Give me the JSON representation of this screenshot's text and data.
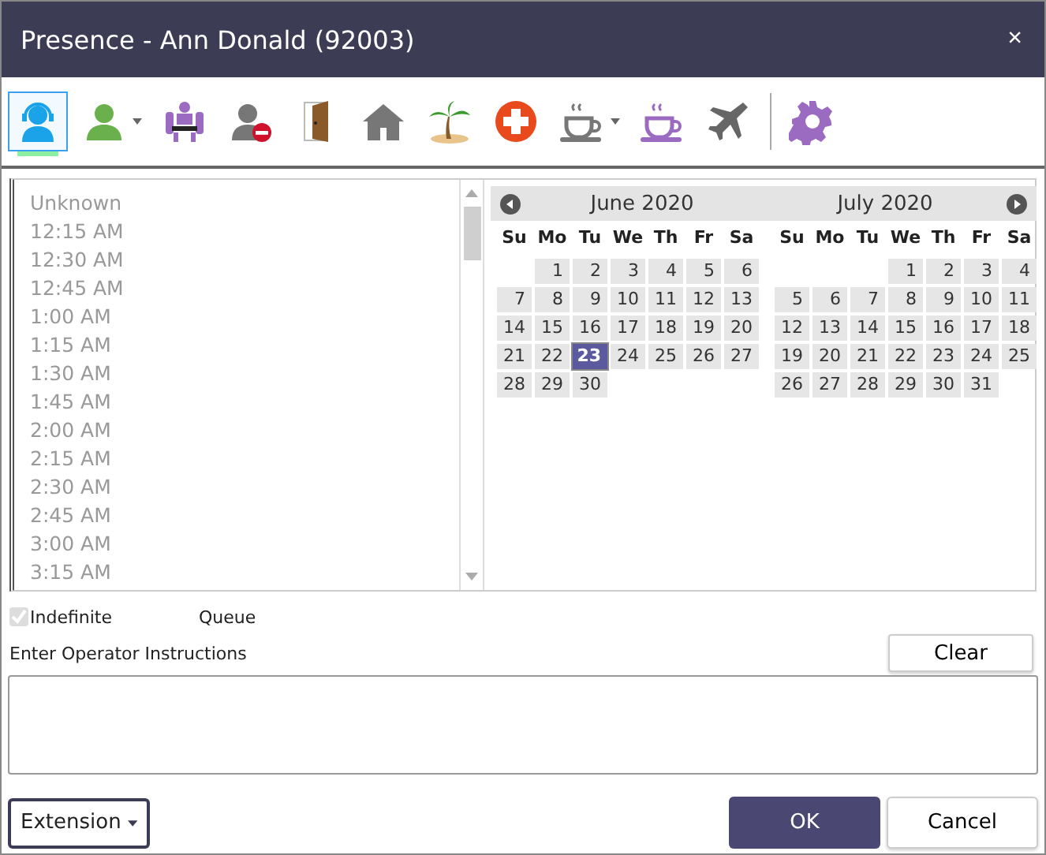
{
  "window": {
    "title": "Presence - Ann Donald (92003)",
    "close": "×"
  },
  "toolbar": [
    {
      "kind": "agent",
      "selected": true,
      "dropdown": false
    },
    {
      "kind": "available",
      "selected": false,
      "dropdown": true
    },
    {
      "kind": "meeting",
      "selected": false,
      "dropdown": false
    },
    {
      "kind": "unavailable",
      "selected": false,
      "dropdown": false
    },
    {
      "kind": "door",
      "selected": false,
      "dropdown": false
    },
    {
      "kind": "home",
      "selected": false,
      "dropdown": false
    },
    {
      "kind": "vacation",
      "selected": false,
      "dropdown": false
    },
    {
      "kind": "sick",
      "selected": false,
      "dropdown": false
    },
    {
      "kind": "break",
      "selected": false,
      "dropdown": true
    },
    {
      "kind": "lunch",
      "selected": false,
      "dropdown": false
    },
    {
      "kind": "travel",
      "selected": false,
      "dropdown": false
    },
    {
      "kind": "separator"
    },
    {
      "kind": "settings",
      "selected": false,
      "dropdown": false
    }
  ],
  "times": [
    "Unknown",
    "12:15 AM",
    "12:30 AM",
    "12:45 AM",
    "1:00 AM",
    "1:15 AM",
    "1:30 AM",
    "1:45 AM",
    "2:00 AM",
    "2:15 AM",
    "2:30 AM",
    "2:45 AM",
    "3:00 AM",
    "3:15 AM"
  ],
  "calendar": {
    "months": [
      {
        "title": "June 2020",
        "weekdays": [
          "Su",
          "Mo",
          "Tu",
          "We",
          "Th",
          "Fr",
          "Sa"
        ],
        "weeks": [
          [
            {
              "kind": "empty"
            },
            {
              "kind": "day",
              "label": "1",
              "selected": false
            },
            {
              "kind": "day",
              "label": "2",
              "selected": false
            },
            {
              "kind": "day",
              "label": "3",
              "selected": false
            },
            {
              "kind": "day",
              "label": "4",
              "selected": false
            },
            {
              "kind": "day",
              "label": "5",
              "selected": false
            },
            {
              "kind": "day",
              "label": "6",
              "selected": false
            }
          ],
          [
            {
              "kind": "day",
              "label": "7",
              "selected": false
            },
            {
              "kind": "day",
              "label": "8",
              "selected": false
            },
            {
              "kind": "day",
              "label": "9",
              "selected": false
            },
            {
              "kind": "day",
              "label": "10",
              "selected": false
            },
            {
              "kind": "day",
              "label": "11",
              "selected": false
            },
            {
              "kind": "day",
              "label": "12",
              "selected": false
            },
            {
              "kind": "day",
              "label": "13",
              "selected": false
            }
          ],
          [
            {
              "kind": "day",
              "label": "14",
              "selected": false
            },
            {
              "kind": "day",
              "label": "15",
              "selected": false
            },
            {
              "kind": "day",
              "label": "16",
              "selected": false
            },
            {
              "kind": "day",
              "label": "17",
              "selected": false
            },
            {
              "kind": "day",
              "label": "18",
              "selected": false
            },
            {
              "kind": "day",
              "label": "19",
              "selected": false
            },
            {
              "kind": "day",
              "label": "20",
              "selected": false
            }
          ],
          [
            {
              "kind": "day",
              "label": "21",
              "selected": false
            },
            {
              "kind": "day",
              "label": "22",
              "selected": false
            },
            {
              "kind": "day",
              "label": "23",
              "selected": true
            },
            {
              "kind": "day",
              "label": "24",
              "selected": false
            },
            {
              "kind": "day",
              "label": "25",
              "selected": false
            },
            {
              "kind": "day",
              "label": "26",
              "selected": false
            },
            {
              "kind": "day",
              "label": "27",
              "selected": false
            }
          ],
          [
            {
              "kind": "day",
              "label": "28",
              "selected": false
            },
            {
              "kind": "day",
              "label": "29",
              "selected": false
            },
            {
              "kind": "day",
              "label": "30",
              "selected": false
            }
          ]
        ]
      },
      {
        "title": "July 2020",
        "weekdays": [
          "Su",
          "Mo",
          "Tu",
          "We",
          "Th",
          "Fr",
          "Sa"
        ],
        "weeks": [
          [
            {
              "kind": "empty"
            },
            {
              "kind": "empty"
            },
            {
              "kind": "empty"
            },
            {
              "kind": "day",
              "label": "1",
              "selected": false
            },
            {
              "kind": "day",
              "label": "2",
              "selected": false
            },
            {
              "kind": "day",
              "label": "3",
              "selected": false
            },
            {
              "kind": "day",
              "label": "4",
              "selected": false
            }
          ],
          [
            {
              "kind": "day",
              "label": "5",
              "selected": false
            },
            {
              "kind": "day",
              "label": "6",
              "selected": false
            },
            {
              "kind": "day",
              "label": "7",
              "selected": false
            },
            {
              "kind": "day",
              "label": "8",
              "selected": false
            },
            {
              "kind": "day",
              "label": "9",
              "selected": false
            },
            {
              "kind": "day",
              "label": "10",
              "selected": false
            },
            {
              "kind": "day",
              "label": "11",
              "selected": false
            }
          ],
          [
            {
              "kind": "day",
              "label": "12",
              "selected": false
            },
            {
              "kind": "day",
              "label": "13",
              "selected": false
            },
            {
              "kind": "day",
              "label": "14",
              "selected": false
            },
            {
              "kind": "day",
              "label": "15",
              "selected": false
            },
            {
              "kind": "day",
              "label": "16",
              "selected": false
            },
            {
              "kind": "day",
              "label": "17",
              "selected": false
            },
            {
              "kind": "day",
              "label": "18",
              "selected": false
            }
          ],
          [
            {
              "kind": "day",
              "label": "19",
              "selected": false
            },
            {
              "kind": "day",
              "label": "20",
              "selected": false
            },
            {
              "kind": "day",
              "label": "21",
              "selected": false
            },
            {
              "kind": "day",
              "label": "22",
              "selected": false
            },
            {
              "kind": "day",
              "label": "23",
              "selected": false
            },
            {
              "kind": "day",
              "label": "24",
              "selected": false
            },
            {
              "kind": "day",
              "label": "25",
              "selected": false
            }
          ],
          [
            {
              "kind": "day",
              "label": "26",
              "selected": false
            },
            {
              "kind": "day",
              "label": "27",
              "selected": false
            },
            {
              "kind": "day",
              "label": "28",
              "selected": false
            },
            {
              "kind": "day",
              "label": "29",
              "selected": false
            },
            {
              "kind": "day",
              "label": "30",
              "selected": false
            },
            {
              "kind": "day",
              "label": "31",
              "selected": false
            }
          ]
        ]
      }
    ]
  },
  "indefinite": {
    "label": "Indefinite",
    "checked": true,
    "disabled": true
  },
  "queue_label": "Queue",
  "instructions": {
    "label": "Enter Operator Instructions",
    "clear": "Clear"
  },
  "footer": {
    "extension": "Extension",
    "ok": "OK",
    "cancel": "Cancel"
  }
}
